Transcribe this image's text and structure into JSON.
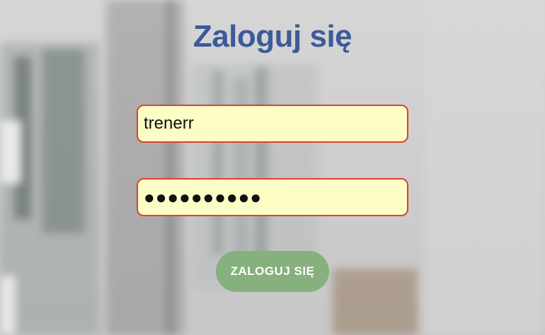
{
  "login": {
    "title": "Zaloguj się",
    "username_value": "trenerr",
    "password_value": "●●●●●●●●●●",
    "submit_label": "ZALOGUJ SIĘ"
  },
  "colors": {
    "title": "#3d5a99",
    "field_border": "#e0402a",
    "field_background": "#fdfdc6",
    "button_background": "#86b07e",
    "button_text": "#ffffff"
  }
}
